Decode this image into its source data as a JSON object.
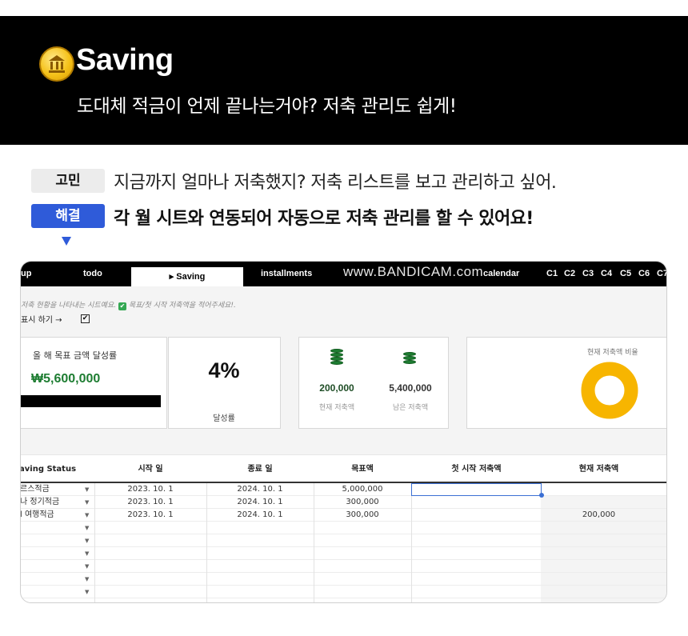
{
  "header": {
    "title": "Saving",
    "subtitle": "도대체 적금이 언제 끝나는거야? 저축 관리도 쉽게!",
    "icon": "bank-coin-icon"
  },
  "problem": {
    "tag": "고민",
    "text": "지금까지 얼마나 저축했지? 저축 리스트를 보고 관리하고 싶어."
  },
  "solution": {
    "tag": "해결",
    "text": "각 월 시트와 연동되어 자동으로 저축 관리를 할 수 있어요!"
  },
  "colors": {
    "banner": "#000000",
    "solution_tag": "#2f5bd9",
    "accent_green": "#1e7d32",
    "donut": "#f7b500",
    "selection": "#3b6fd4"
  },
  "sheet": {
    "tabs": [
      "up",
      "todo",
      "▸ Saving",
      "installments",
      "calendar",
      "C1",
      "C2",
      "C3",
      "C4",
      "C5",
      "C6",
      "C7"
    ],
    "watermark": "www.BANDICAM.com",
    "note": "저축 현황을 나타내는 시트예요.",
    "note_check": "✔",
    "note2": "목표/첫 시작 저축액을 적어주세요!.",
    "toggle_label": "표시 하기 →",
    "toggle_checked": "✔",
    "goal": {
      "title": "올 해 목표 금액 달성률",
      "amount": "₩5,600,000"
    },
    "achievement": {
      "value": "4%",
      "label": "달성률"
    },
    "current": {
      "value": "200,000",
      "label": "현재 저축액"
    },
    "remaining": {
      "value": "5,400,000",
      "label": "남은 저축액"
    },
    "ratio": {
      "label": "현재 저축액 비율"
    },
    "table": {
      "headers": [
        "aving Status",
        "시작 일",
        "종료 일",
        "목표액",
        "첫 시작 저축액",
        "현재 저축액"
      ],
      "rows": [
        {
          "name": "르스적금",
          "start": "2023. 10. 1",
          "end": "2024. 10. 1",
          "target": "5,000,000",
          "first": "",
          "current": ""
        },
        {
          "name": "나 정기적금",
          "start": "2023. 10. 1",
          "end": "2024. 10. 1",
          "target": "300,000",
          "first": "",
          "current": ""
        },
        {
          "name": "l 여행적금",
          "start": "2023. 10. 1",
          "end": "2024. 10. 1",
          "target": "300,000",
          "first": "",
          "current": "200,000"
        }
      ],
      "empty_rows": 6
    }
  }
}
